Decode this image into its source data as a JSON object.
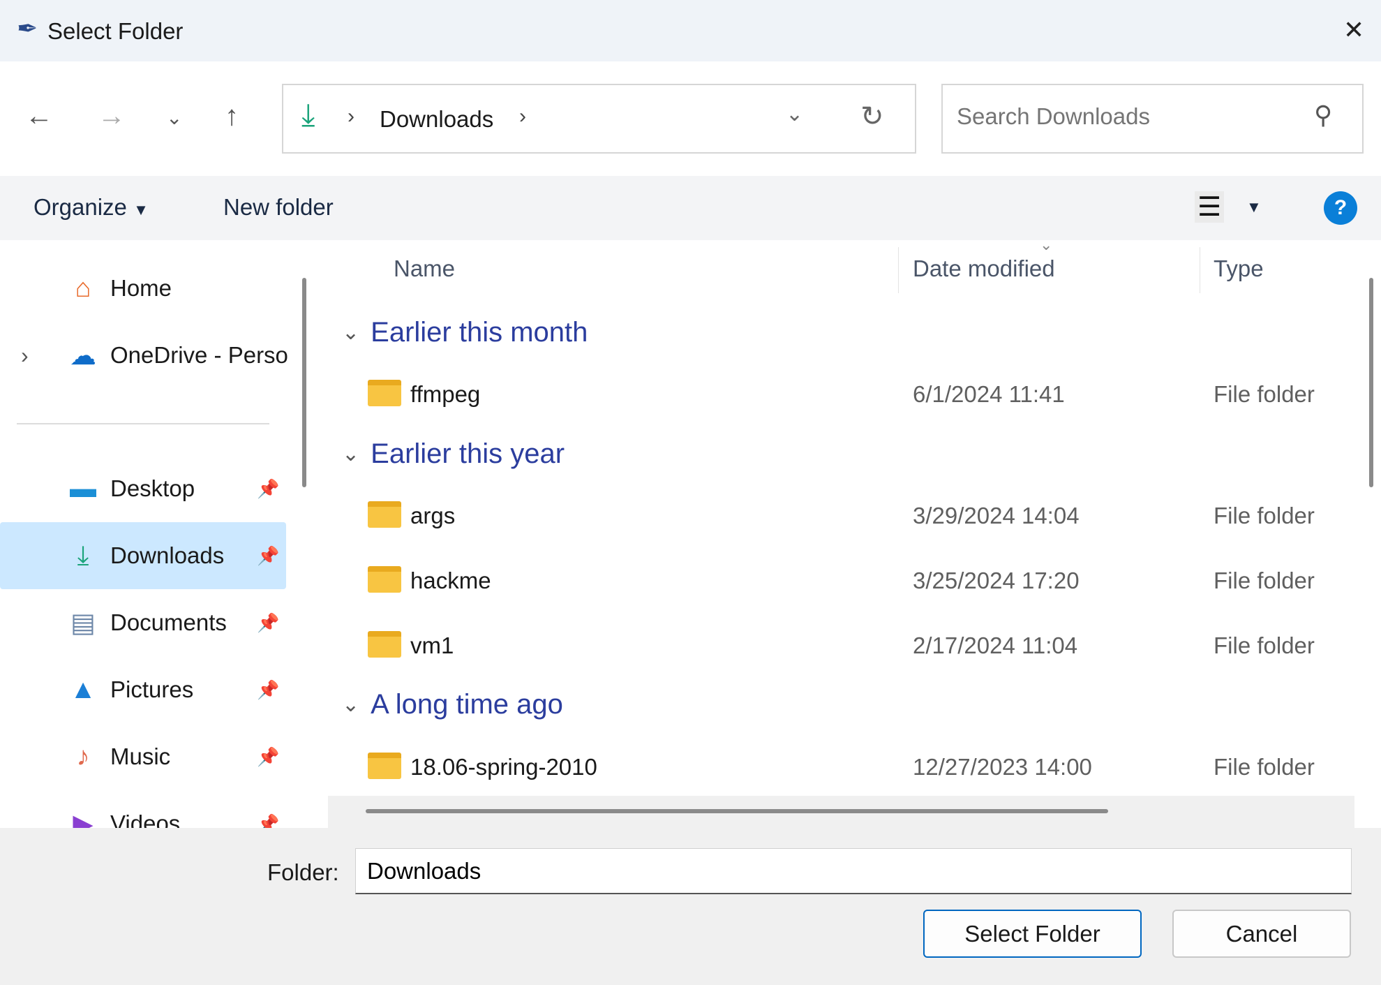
{
  "window": {
    "title": "Select Folder",
    "icon": "feather-icon"
  },
  "nav": {
    "breadcrumb": [
      "Downloads"
    ],
    "search_placeholder": "Search Downloads"
  },
  "toolbar": {
    "organize": "Organize",
    "new_folder": "New folder"
  },
  "sidebar": {
    "items": [
      {
        "label": "Home",
        "icon": "home-icon"
      },
      {
        "label": "OneDrive - Personal",
        "icon": "cloud-icon"
      },
      {
        "label": "Desktop",
        "icon": "desktop-icon",
        "pinned": true
      },
      {
        "label": "Downloads",
        "icon": "download-icon",
        "pinned": true,
        "selected": true
      },
      {
        "label": "Documents",
        "icon": "document-icon",
        "pinned": true
      },
      {
        "label": "Pictures",
        "icon": "pictures-icon",
        "pinned": true
      },
      {
        "label": "Music",
        "icon": "music-icon",
        "pinned": true
      },
      {
        "label": "Videos",
        "icon": "videos-icon",
        "pinned": true
      }
    ]
  },
  "columns": [
    "Name",
    "Date modified",
    "Type"
  ],
  "groups": [
    {
      "label": "Earlier this month",
      "rows": [
        {
          "name": "ffmpeg",
          "date": "6/1/2024 11:41",
          "type": "File folder"
        }
      ]
    },
    {
      "label": "Earlier this year",
      "rows": [
        {
          "name": "args",
          "date": "3/29/2024 14:04",
          "type": "File folder"
        },
        {
          "name": "hackme",
          "date": "3/25/2024 17:20",
          "type": "File folder"
        },
        {
          "name": "vm1",
          "date": "2/17/2024 11:04",
          "type": "File folder"
        }
      ]
    },
    {
      "label": "A long time ago",
      "rows": [
        {
          "name": "18.06-spring-2010",
          "date": "12/27/2023 14:00",
          "type": "File folder"
        }
      ]
    }
  ],
  "footer": {
    "folder_label": "Folder:",
    "folder_value": "Downloads",
    "select_button": "Select Folder",
    "cancel_button": "Cancel"
  },
  "colors": {
    "accent": "#0067c0",
    "selected_bg": "#cce8ff",
    "group_heading": "#2b3d9e"
  }
}
